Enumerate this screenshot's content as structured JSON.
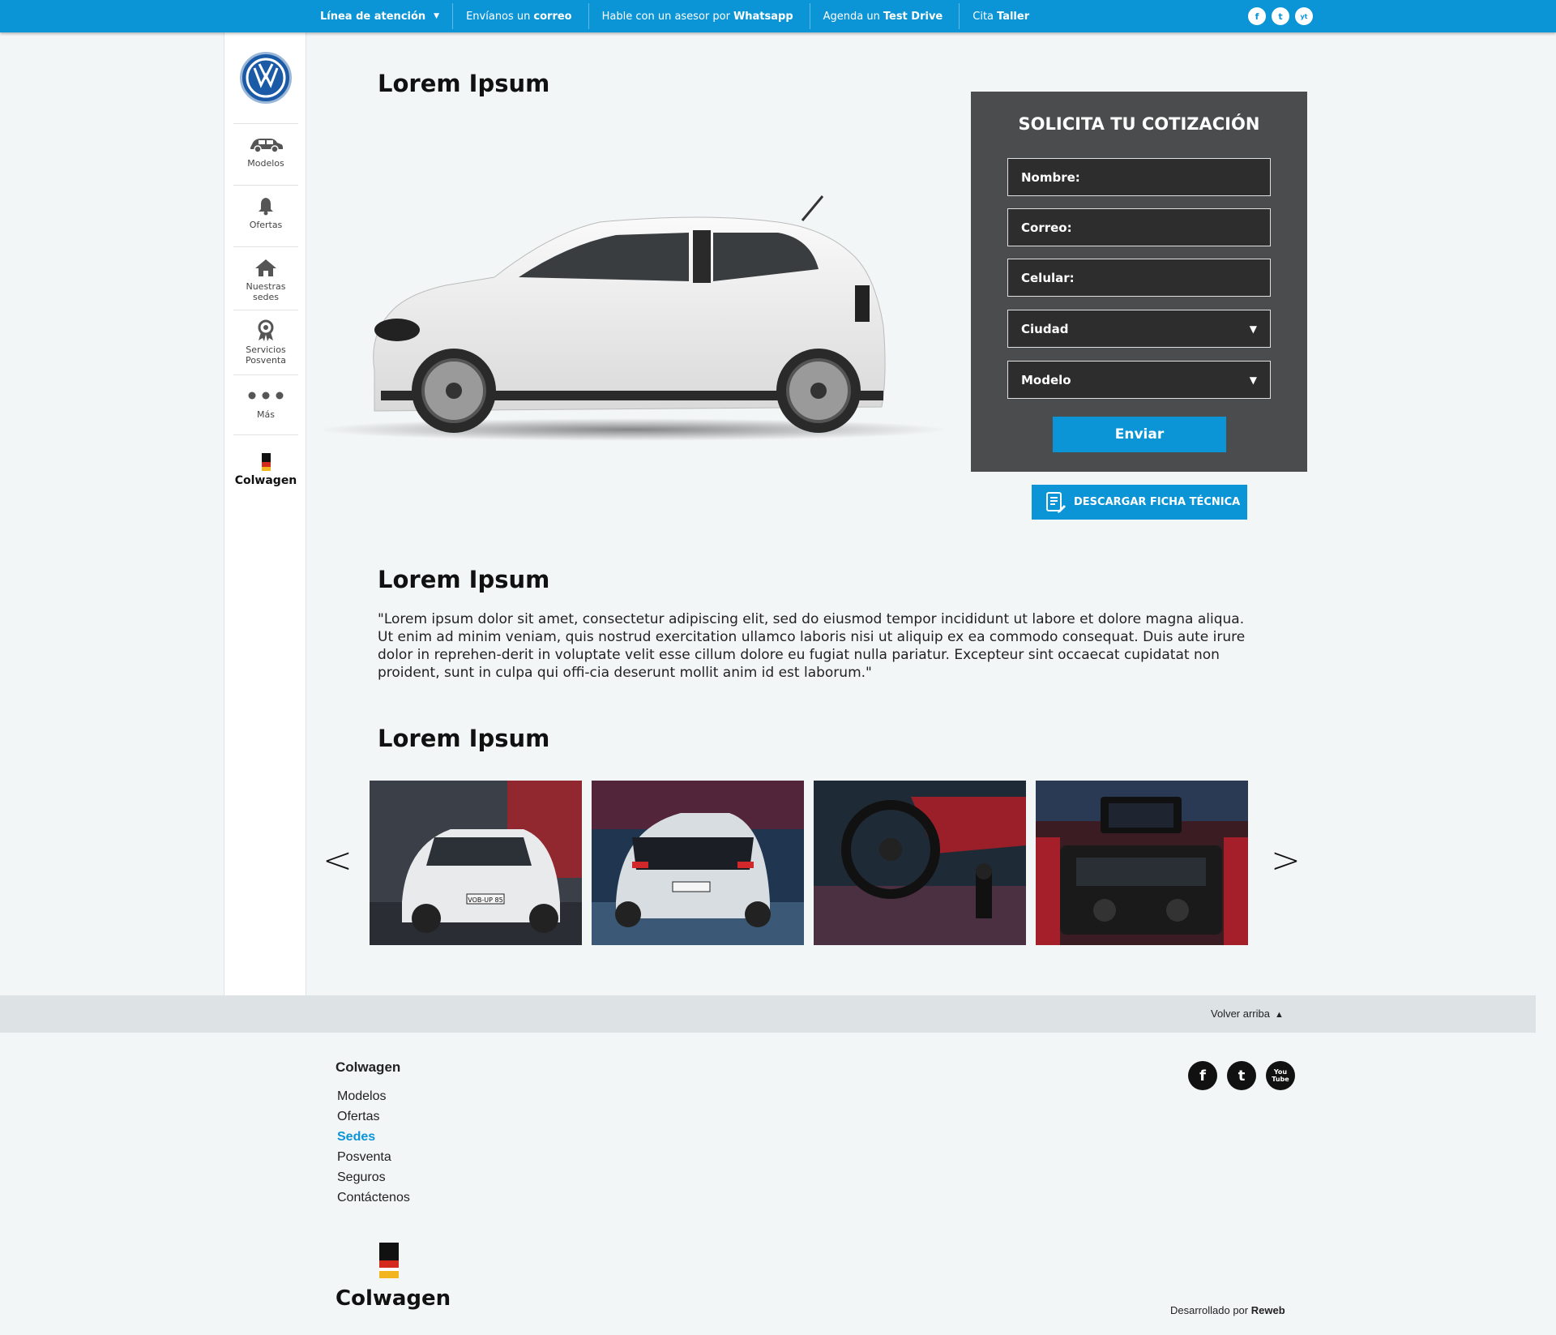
{
  "topbar": {
    "items": [
      {
        "pre": "",
        "bold": "Línea de atención",
        "post": ""
      },
      {
        "pre": "Envíanos un",
        "bold": "correo",
        "post": ""
      },
      {
        "pre": "Hable con un asesor por",
        "bold": "Whatsapp",
        "post": ""
      },
      {
        "pre": "Agenda un",
        "bold": "Test Drive",
        "post": ""
      },
      {
        "pre": "Cita",
        "bold": "Taller",
        "post": ""
      }
    ],
    "social": [
      "f",
      "t",
      "yt"
    ]
  },
  "sidebar": {
    "items": [
      {
        "label": "Modelos"
      },
      {
        "label": "Ofertas"
      },
      {
        "label": "Nuestras sedes"
      },
      {
        "label": "Servicios Posventa"
      },
      {
        "label": "Más"
      }
    ],
    "brand": "Colwagen"
  },
  "main": {
    "title1": "Lorem Ipsum",
    "title2": "Lorem Ipsum",
    "title3": "Lorem Ipsum",
    "paragraph": "\"Lorem ipsum dolor sit amet, consectetur adipiscing elit, sed do eiusmod tempor incididunt ut labore et dolore magna aliqua. Ut enim ad minim veniam, quis nostrud exercitation ullamco laboris nisi ut aliquip ex ea commodo consequat. Duis aute irure dolor in reprehen-derit in voluptate velit esse cillum dolore eu fugiat nulla pariatur. Excepteur sint occaecat cupidatat non proident, sunt in culpa qui offi-cia deserunt mollit anim id est laborum.\"",
    "download_label": "DESCARGAR FICHA TÉCNICA",
    "gallery_prev": "<",
    "gallery_next": ">",
    "car_plate": "VOB-UP 85"
  },
  "quote_form": {
    "title": "SOLICITA TU COTIZACIÓN",
    "name_label": "Nombre:",
    "email_label": "Correo:",
    "phone_label": "Celular:",
    "city_label": "Ciudad",
    "model_label": "Modelo",
    "submit_label": "Enviar"
  },
  "footer": {
    "back_to_top": "Volver arriba",
    "brand": "Colwagen",
    "links": [
      "Modelos",
      "Ofertas",
      "Sedes",
      "Posventa",
      "Seguros",
      "Contáctenos"
    ],
    "active_link": "Sedes",
    "dev_prefix": "Desarrollado por",
    "dev_name": "Reweb",
    "logo_text": "Colwagen",
    "social": [
      "f",
      "t",
      "You Tube"
    ]
  },
  "colors": {
    "accent": "#0b95d6",
    "panel": "#4b4c4d",
    "background": "#f3f6f7"
  }
}
